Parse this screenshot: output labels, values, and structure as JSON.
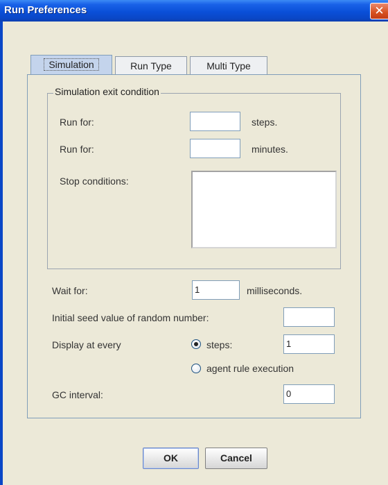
{
  "window": {
    "title": "Run Preferences",
    "close_glyph": "✕"
  },
  "tabs": [
    {
      "label": "Simulation",
      "active": true
    },
    {
      "label": "Run Type",
      "active": false
    },
    {
      "label": "Multi Type",
      "active": false
    }
  ],
  "exit_group": {
    "title": "Simulation exit condition",
    "run_steps_label": "Run for:",
    "run_steps_value": "",
    "run_steps_unit": "steps.",
    "run_minutes_label": "Run for:",
    "run_minutes_value": "",
    "run_minutes_unit": "minutes.",
    "stop_conditions_label": "Stop conditions:"
  },
  "wait": {
    "label": "Wait for:",
    "value": "1",
    "unit": "milliseconds."
  },
  "seed": {
    "label": "Initial seed value of random number:",
    "value": ""
  },
  "display": {
    "label": "Display at every",
    "steps_option": "steps:",
    "steps_value": "1",
    "agent_option": "agent rule execution",
    "selected": "steps"
  },
  "gc": {
    "label": "GC interval:",
    "value": "0"
  },
  "buttons": {
    "ok": "OK",
    "cancel": "Cancel"
  }
}
